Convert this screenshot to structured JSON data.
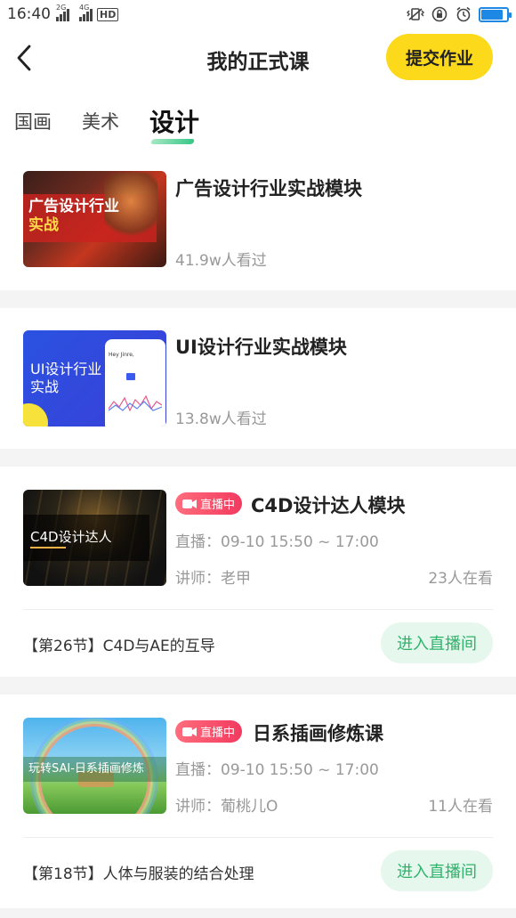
{
  "status_bar": {
    "time": "16:40",
    "signal_1": "2G",
    "signal_2": "4G",
    "hd": "HD",
    "battery_level": 0.85
  },
  "header": {
    "title": "我的正式课",
    "submit_label": "提交作业"
  },
  "tabs": [
    {
      "label": "国画",
      "active": false
    },
    {
      "label": "美术",
      "active": false
    },
    {
      "label": "设计",
      "active": true
    }
  ],
  "courses": [
    {
      "title": "广告设计行业实战模块",
      "views": "41.9w人看过",
      "thumb_text_1": "广告设计行业",
      "thumb_text_2": "实战"
    },
    {
      "title": "UI设计行业实战模块",
      "views": "13.8w人看过",
      "thumb_text_1": "UI设计行业",
      "thumb_text_2": "实战",
      "thumb_greeting": "Hey Jinre,"
    }
  ],
  "live_courses": [
    {
      "badge": "直播中",
      "title": "C4D设计达人模块",
      "time": "直播：09-10 15:50 ~ 17:00",
      "teacher": "讲师：老甲",
      "watching": "23人在看",
      "thumb_text": "C4D设计达人",
      "lesson": "【第26节】C4D与AE的互导",
      "enter_label": "进入直播间"
    },
    {
      "badge": "直播中",
      "title": "日系插画修炼课",
      "time": "直播：09-10 15:50 ~ 17:00",
      "teacher": "讲师：葡桃儿O",
      "watching": "11人在看",
      "thumb_text": "玩转SAI-日系插画修炼",
      "lesson": "【第18节】人体与服装的结合处理",
      "enter_label": "进入直播间"
    }
  ],
  "colors": {
    "accent_yellow": "#fcd91a",
    "live_red": "#f23a5f",
    "enter_green": "#2fb36a"
  }
}
